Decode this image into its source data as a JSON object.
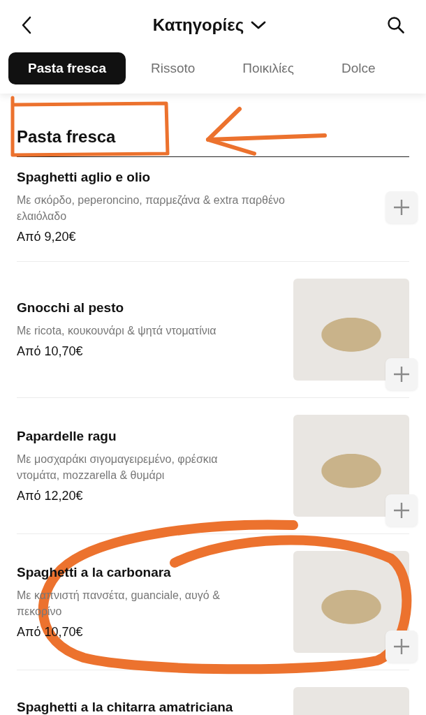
{
  "header": {
    "title": "Κατηγορίες"
  },
  "tabs": [
    {
      "label": "Pasta fresca",
      "selected": true
    },
    {
      "label": "Rissoto",
      "selected": false
    },
    {
      "label": "Ποικιλίες",
      "selected": false
    },
    {
      "label": "Dolce",
      "selected": false
    }
  ],
  "section": {
    "title": "Pasta fresca"
  },
  "items": [
    {
      "name": "Spaghetti aglio e olio",
      "description": "Με σκόρδο, peperoncino, παρμεζάνα & extra παρθένο ελαιόλαδο",
      "price": "Από 9,20€",
      "has_photo": false
    },
    {
      "name": "Gnocchi al pesto",
      "description": "Με ricota, κουκουνάρι & ψητά ντοματίνια",
      "price": "Από 10,70€",
      "has_photo": true
    },
    {
      "name": "Papardelle ragu",
      "description": "Με μοσχαράκι σιγομαγειρεμένο, φρέσκια ντομάτα, mozzarella & θυμάρι",
      "price": "Από 12,20€",
      "has_photo": true
    },
    {
      "name": "Spaghetti a la carbonara",
      "description": "Με καπνιστή πανσέτα, guanciale, αυγό & πεκορίνο",
      "price": "Από 10,70€",
      "has_photo": true
    },
    {
      "name": "Spaghetti a la chitarra amatriciana",
      "has_photo": true
    }
  ]
}
